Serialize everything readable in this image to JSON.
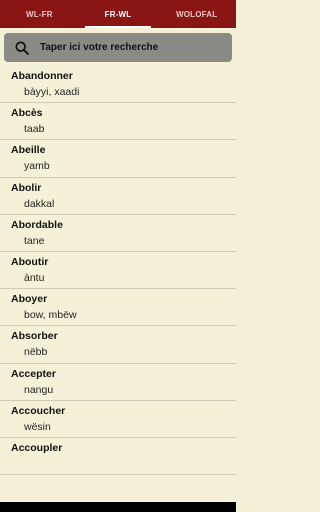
{
  "tabs": [
    {
      "label": "WL-FR",
      "active": false
    },
    {
      "label": "FR-WL",
      "active": true
    },
    {
      "label": "WOLOFAL",
      "active": false
    }
  ],
  "search": {
    "placeholder": "Taper ici votre recherche",
    "icon": "search-icon"
  },
  "entries": [
    {
      "french": "Abandonner",
      "wolof": "bàyyi, xaadi"
    },
    {
      "french": "Abcès",
      "wolof": "taab"
    },
    {
      "french": "Abeille",
      "wolof": "yamb"
    },
    {
      "french": "Abolir",
      "wolof": "dakkal"
    },
    {
      "french": "Abordable",
      "wolof": "tane"
    },
    {
      "french": "Aboutir",
      "wolof": "àntu"
    },
    {
      "french": "Aboyer",
      "wolof": "bow, mbëw"
    },
    {
      "french": "Absorber",
      "wolof": "nëbb"
    },
    {
      "french": "Accepter",
      "wolof": "nangu"
    },
    {
      "french": "Accoucher",
      "wolof": "wësin"
    },
    {
      "french": "Accoupler",
      "wolof": ""
    }
  ],
  "colors": {
    "header": "#8a1515",
    "background": "#f5f1d8",
    "search_box": "#8a8a86"
  }
}
